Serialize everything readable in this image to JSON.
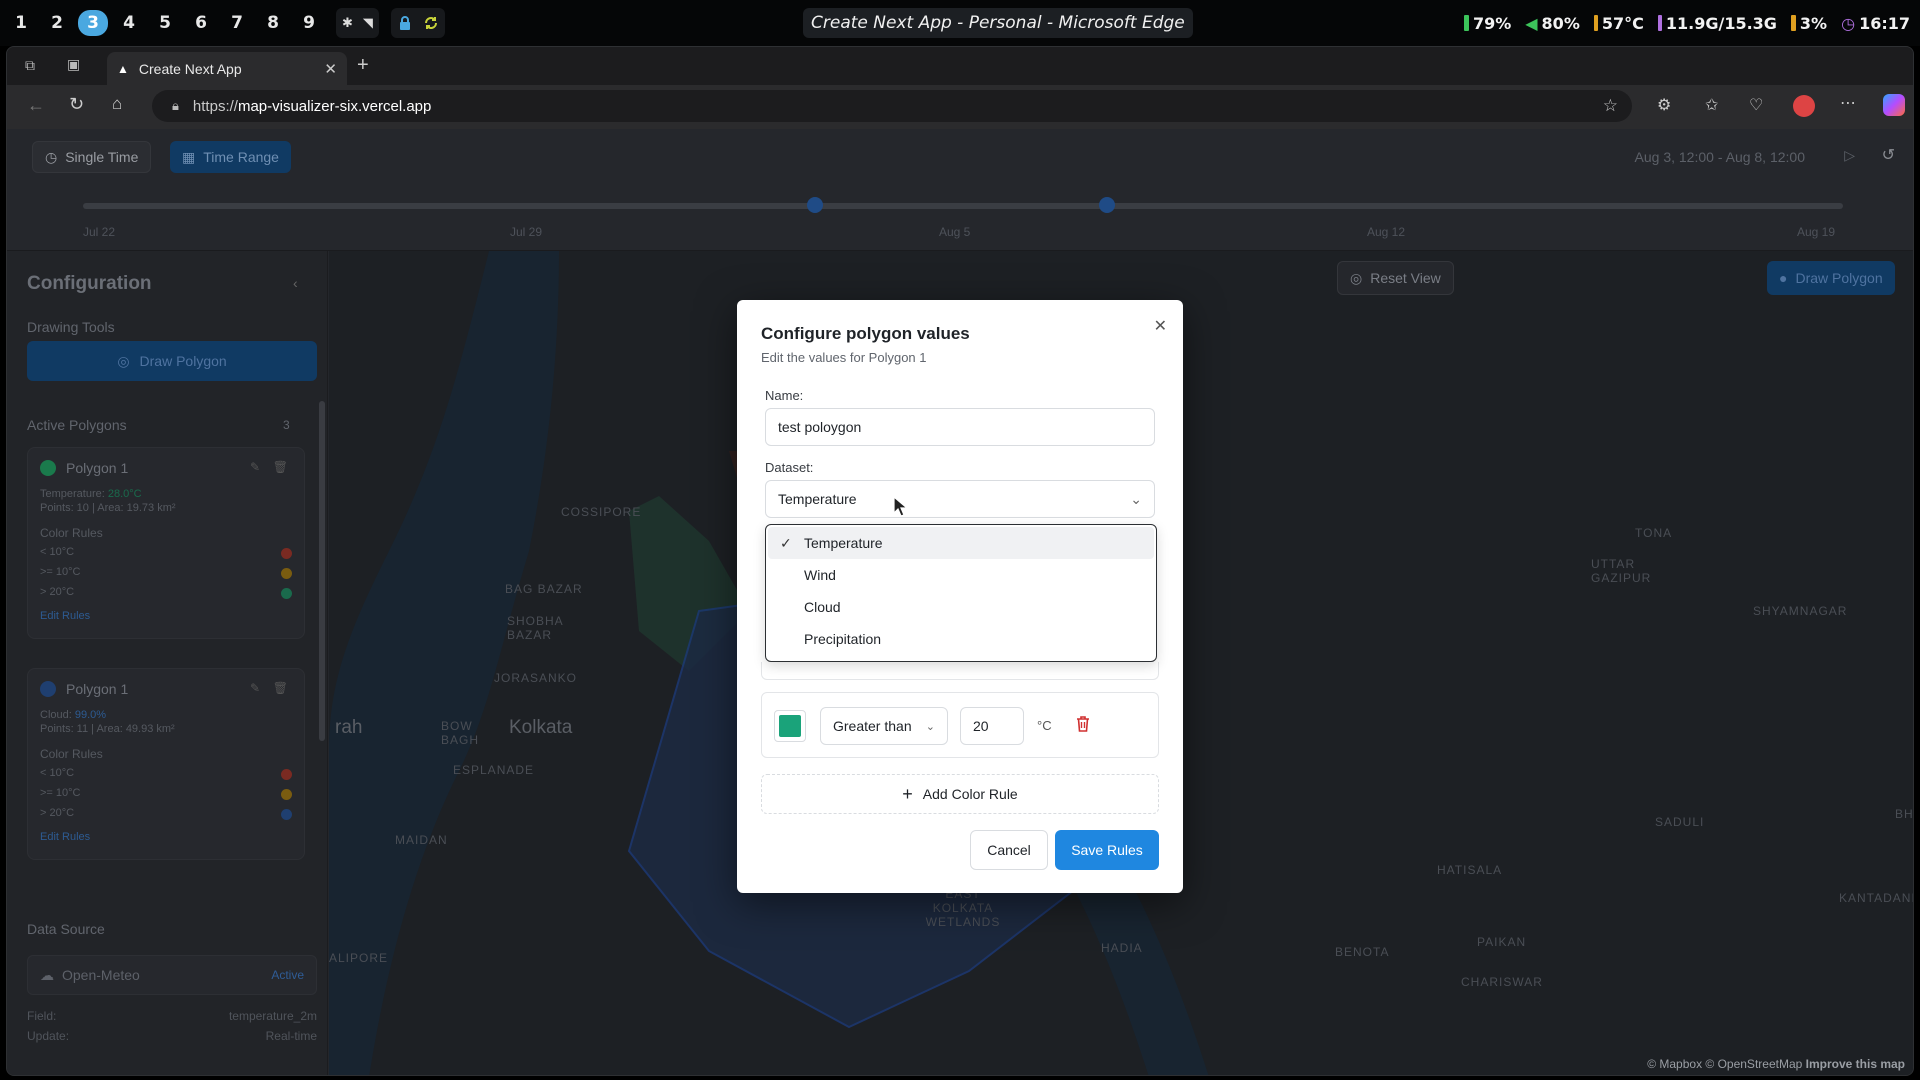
{
  "taskbar": {
    "workspaces": [
      "1",
      "2",
      "3",
      "4",
      "5",
      "6",
      "7",
      "8",
      "9"
    ],
    "active_workspace": "3",
    "window_title": "Create Next App - Personal - Microsoft Edge",
    "stats": {
      "battery": "79%",
      "volume": "80%",
      "temp": "57°C",
      "memory": "11.9G/15.3G",
      "cpu": "3%",
      "clock": "16:17"
    }
  },
  "browser": {
    "tab_title": "Create Next App",
    "url_prefix": "https://",
    "url_host": "map-visualizer-six.vercel.app"
  },
  "timebar": {
    "single_time": "Single Time",
    "time_range": "Time Range",
    "range_text": "Aug 3, 12:00 - Aug 8, 12:00",
    "ticks": [
      "Jul 22",
      "Jul 29",
      "Aug 5",
      "Aug 12",
      "Aug 19"
    ]
  },
  "sidebar": {
    "title": "Configuration",
    "drawing_tools": "Drawing Tools",
    "draw_polygon": "Draw Polygon",
    "active_polygons": "Active Polygons",
    "polygon_count": "3",
    "polygons": [
      {
        "name": "Polygon 1",
        "metric_label": "Temperature:",
        "metric_value": "28.0°C",
        "points": "Points: 10 | Area: 19.73 km²",
        "color_rules_label": "Color Rules",
        "rules": [
          "< 10°C",
          ">= 10°C",
          "> 20°C"
        ],
        "edit": "Edit Rules"
      },
      {
        "name": "Polygon 1",
        "metric_label": "Cloud:",
        "metric_value": "99.0%",
        "points": "Points: 11 | Area: 49.93 km²",
        "color_rules_label": "Color Rules",
        "rules": [
          "< 10°C",
          ">= 10°C",
          "> 20°C"
        ],
        "edit": "Edit Rules"
      }
    ],
    "data_source": "Data Source",
    "source_name": "Open-Meteo",
    "source_status": "Active",
    "field_label": "Field:",
    "field_value": "temperature_2m",
    "update_label": "Update:",
    "update_value": "Real-time"
  },
  "map": {
    "reset_view": "Reset View",
    "draw_polygon": "Draw Polygon",
    "labels": {
      "cossipore": "COSSIPORE",
      "bag_bazar": "BAG BAZAR",
      "shobha_bazar": "SHOBHA BAZAR",
      "jorasanko": "JORASANKO",
      "kolkata": "Kolkata",
      "rah": "rah",
      "bow_bagh": "BOW BAGH",
      "esplanade": "ESPLANADE",
      "maidan": "MAIDAN",
      "alipore": "ALIPORE",
      "east_kolkata_wetlands": "EAST KOLKATA WETLANDS",
      "hadia": "HADIA",
      "tona": "TONA",
      "uttar_gazipur": "UTTAR GAZIPUR",
      "shyamnagar": "SHYAMNAGAR",
      "saduli": "SADULI",
      "hatisala": "HATISALA",
      "kantadani": "KANTADANI",
      "benota": "BENOTA",
      "paikan": "PAIKAN",
      "chariswar": "CHARISWAR",
      "bh": "BH"
    },
    "attribution": "© Mapbox © OpenStreetMap",
    "improve": "Improve this map"
  },
  "modal": {
    "title": "Configure polygon values",
    "subtitle": "Edit the values for Polygon 1",
    "name_label": "Name:",
    "name_value": "test poloygon",
    "dataset_label": "Dataset:",
    "dataset_value": "Temperature",
    "options": [
      "Temperature",
      "Wind",
      "Cloud",
      "Precipitation"
    ],
    "rule_operator": "Greater than",
    "rule_value": "20",
    "rule_unit": "°C",
    "rule_color": "#1aa37a",
    "add_rule": "Add Color Rule",
    "cancel": "Cancel",
    "save": "Save Rules"
  },
  "colors": {
    "accent": "#1f87e0",
    "rule_red": "#b83a2e",
    "rule_amber": "#b8860b",
    "rule_green": "#1aa37a",
    "rule_blue": "#1f4b86"
  }
}
